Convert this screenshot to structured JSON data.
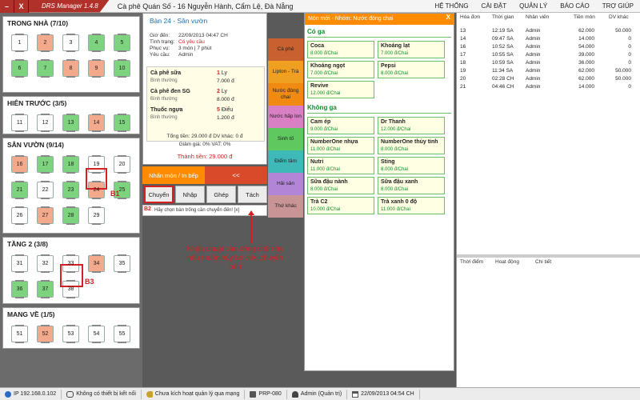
{
  "titlebar": {
    "min": "–",
    "close": "X",
    "app_title": "DRS Manager 1.4.8",
    "shop_name": "Cà phê Quán Số - 16 Nguyễn Hành, Cẩm Lệ, Đà Nẵng",
    "menu": [
      "HỆ THỐNG",
      "CÀI ĐẶT",
      "QUẢN LÝ",
      "BÁO CÁO",
      "TRỢ GIÚP"
    ]
  },
  "areas": [
    {
      "title": "TRONG NHÀ  (7/10)",
      "tables": [
        {
          "n": "1",
          "s": "empty"
        },
        {
          "n": "2",
          "s": "order"
        },
        {
          "n": "3",
          "s": "empty"
        },
        {
          "n": "4",
          "s": "busy"
        },
        {
          "n": "5",
          "s": "busy"
        },
        {
          "n": "6",
          "s": "busy"
        },
        {
          "n": "7",
          "s": "busy"
        },
        {
          "n": "8",
          "s": "order"
        },
        {
          "n": "9",
          "s": "order"
        },
        {
          "n": "10",
          "s": "busy"
        }
      ]
    },
    {
      "title": "HIÊN TRƯỚC  (3/5)",
      "tables": [
        {
          "n": "11",
          "s": "empty"
        },
        {
          "n": "12",
          "s": "empty"
        },
        {
          "n": "13",
          "s": "busy"
        },
        {
          "n": "14",
          "s": "order"
        },
        {
          "n": "15",
          "s": "busy"
        }
      ]
    },
    {
      "title": "SÂN VƯỜN  (9/14)",
      "tables": [
        {
          "n": "16",
          "s": "order"
        },
        {
          "n": "17",
          "s": "busy"
        },
        {
          "n": "18",
          "s": "busy"
        },
        {
          "n": "19",
          "s": "empty"
        },
        {
          "n": "20",
          "s": "empty"
        },
        {
          "n": "21",
          "s": "busy"
        },
        {
          "n": "22",
          "s": "empty"
        },
        {
          "n": "23",
          "s": "busy"
        },
        {
          "n": "24",
          "s": "order"
        },
        {
          "n": "25",
          "s": "busy"
        },
        {
          "n": "26",
          "s": "empty"
        },
        {
          "n": "27",
          "s": "order"
        },
        {
          "n": "28",
          "s": "busy"
        },
        {
          "n": "29",
          "s": "empty"
        }
      ]
    },
    {
      "title": "TẦNG 2  (3/8)",
      "tables": [
        {
          "n": "31",
          "s": "empty"
        },
        {
          "n": "32",
          "s": "empty"
        },
        {
          "n": "33",
          "s": "empty"
        },
        {
          "n": "34",
          "s": "order"
        },
        {
          "n": "35",
          "s": "empty"
        },
        {
          "n": "36",
          "s": "busy"
        },
        {
          "n": "37",
          "s": "busy"
        },
        {
          "n": "38",
          "s": "empty"
        }
      ]
    },
    {
      "title": "MANG VỀ  (1/5)",
      "tables": [
        {
          "n": "51",
          "s": "empty"
        },
        {
          "n": "52",
          "s": "order"
        },
        {
          "n": "53",
          "s": "empty"
        },
        {
          "n": "54",
          "s": "empty"
        },
        {
          "n": "55",
          "s": "empty"
        }
      ]
    }
  ],
  "annotations": {
    "b1": "B1",
    "b2": "B2",
    "b3": "B3",
    "note": "Nhấn chuột vào dòng chữ này nếu muốn hủy bỏ việc chuyển bàn"
  },
  "order": {
    "title": "Bàn 24 - Sân vườn",
    "fields": [
      {
        "k": "Giờ đến:",
        "v": "22/09/2013 04:47 CH"
      },
      {
        "k": "Tình trạng:",
        "v": "Có yêu cầu"
      },
      {
        "k": "Phục vụ:",
        "v": "3 món  |  7 phút"
      },
      {
        "k": "Yêu cầu:",
        "v": "Admin"
      }
    ],
    "items": [
      {
        "name": "Cà phê sữa",
        "sub": "Bình thường",
        "qty": "1",
        "unit": "Ly",
        "price": "7.000 đ"
      },
      {
        "name": "Cà phê đen SG",
        "sub": "Bình thường",
        "qty": "2",
        "unit": "Ly",
        "price": "8.000 đ"
      },
      {
        "name": "Thuốc ngựa",
        "sub": "Bình thường",
        "qty": "5",
        "unit": "Điếu",
        "price": "1.200 đ"
      }
    ],
    "total_line": "Tổng tiền: 29.000 đ      DV khác: 0 đ",
    "discount_line": "Giảm giá: 0%     VAT: 0%",
    "grand_total": "Thành tiền: 29.000 đ"
  },
  "actions": {
    "send": "Nhấn món / In bếp",
    "back": "<<",
    "tools": [
      "Chuyển",
      "Nhập",
      "Ghép",
      "Tách"
    ],
    "hint": "Hãy chọn bàn trống cần chuyển đến!  [x]"
  },
  "categories": [
    {
      "label": "Cà phê",
      "color": "#c8612f"
    },
    {
      "label": "Lipton - Trà",
      "color": "#f0a020"
    },
    {
      "label": "Nước đóng chai",
      "color": "#f08a10"
    },
    {
      "label": "Nước hấp lon",
      "color": "#d97fc4"
    },
    {
      "label": "Sinh tố",
      "color": "#5fc95f"
    },
    {
      "label": "Điểm tâm",
      "color": "#3fb8b8"
    },
    {
      "label": "Hải sản",
      "color": "#b285d6"
    },
    {
      "label": "Thứ khác",
      "color": "#c89496"
    }
  ],
  "menu": {
    "header": "Món mới - Nhóm: Nước đóng chai",
    "close": "X",
    "sections": [
      {
        "title": "Có ga",
        "products": [
          {
            "name": "Coca",
            "price": "8.000 đ/Chai"
          },
          {
            "name": "Khoáng lạt",
            "price": "7.000 đ/Chai"
          },
          {
            "name": "Khoáng ngọt",
            "price": "7.000 đ/Chai"
          },
          {
            "name": "Pepsi",
            "price": "8.000 đ/Chai"
          },
          {
            "name": "Revive",
            "price": "12.000 đ/Chai"
          }
        ]
      },
      {
        "title": "Không ga",
        "products": [
          {
            "name": "Cam ép",
            "price": "9.000 đ/Chai"
          },
          {
            "name": "Dr Thanh",
            "price": "12.000 đ/Chai"
          },
          {
            "name": "NumberOne nhựa",
            "price": "11.000 đ/Chai"
          },
          {
            "name": "NumberOne thủy tinh",
            "price": "8.000 đ/Chai"
          },
          {
            "name": "Nutri",
            "price": "11.000 đ/Chai"
          },
          {
            "name": "Sting",
            "price": "8.000 đ/Chai"
          },
          {
            "name": "Sữa đậu nành",
            "price": "8.000 đ/Chai"
          },
          {
            "name": "Sữa đậu xanh",
            "price": "8.000 đ/Chai"
          },
          {
            "name": "Trà C2",
            "price": "10.000 đ/Chai"
          },
          {
            "name": "Trà xanh 0 độ",
            "price": "11.000 đ/Chai"
          }
        ]
      }
    ]
  },
  "invoices": {
    "headers": [
      "Hóa đơn",
      "Thời gian",
      "Nhân viên",
      "Tiền món",
      "DV khác"
    ],
    "rows": [
      [
        "13",
        "12:19 SA",
        "Admin",
        "62.000",
        "50.000"
      ],
      [
        "14",
        "09:47 SA",
        "Admin",
        "14.000",
        "0"
      ],
      [
        "16",
        "10:52 SA",
        "Admin",
        "54.000",
        "0"
      ],
      [
        "17",
        "10:55 SA",
        "Admin",
        "39.000",
        "0"
      ],
      [
        "18",
        "10:59 SA",
        "Admin",
        "36.000",
        "0"
      ],
      [
        "19",
        "11:34 SA",
        "Admin",
        "62.000",
        "50.000"
      ],
      [
        "20",
        "02:28 CH",
        "Admin",
        "62.000",
        "50.000"
      ],
      [
        "21",
        "04:46 CH",
        "Admin",
        "14.000",
        "0"
      ]
    ]
  },
  "log": {
    "headers": [
      "Thời điểm",
      "Hoạt động",
      "Chi tiết"
    ]
  },
  "status": {
    "ip": "IP 192.168.0.102",
    "device": "Không có thiết bị kết nối",
    "license": "Chưa kích hoạt quản lý qua mạng",
    "printer": "PRP-080",
    "user": "Admin (Quản trị)",
    "datetime": "22/09/2013 04:54 CH"
  }
}
